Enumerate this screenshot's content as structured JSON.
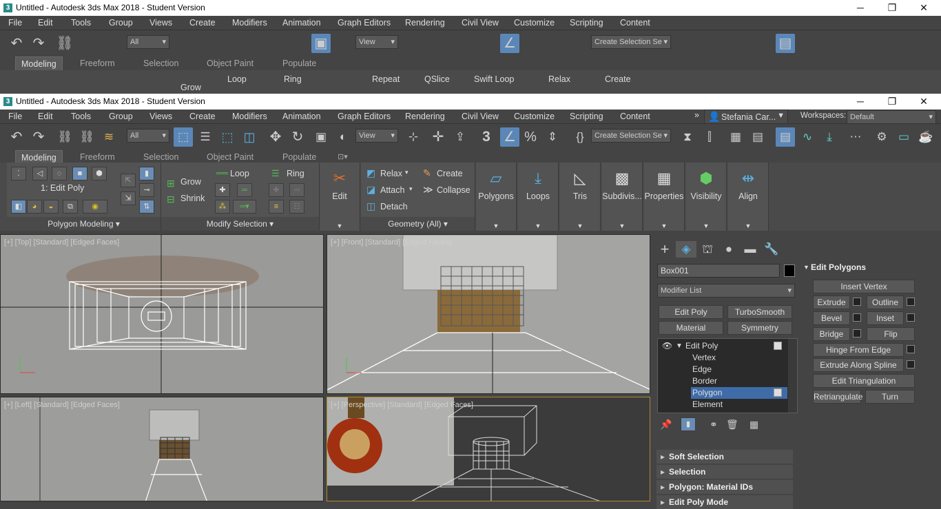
{
  "window": {
    "title": "Untitled - Autodesk 3ds Max 2018 - Student Version",
    "minimize": "─",
    "restore": "❐",
    "close": "✕"
  },
  "menu": [
    "File",
    "Edit",
    "Tools",
    "Group",
    "Views",
    "Create",
    "Modifiers",
    "Animation",
    "Graph Editors",
    "Rendering",
    "Civil View",
    "Customize",
    "Scripting",
    "Content"
  ],
  "user": {
    "name": "Stefania Car...",
    "workspaces_label": "Workspaces:",
    "workspace": "Default",
    "more": "»"
  },
  "toolbar": {
    "filter": "All",
    "view": "View",
    "selection_set": "Create Selection Se",
    "snap_label": "3"
  },
  "ribbon_tabs": [
    "Modeling",
    "Freeform",
    "Selection",
    "Object Paint",
    "Populate"
  ],
  "ribbon": {
    "edit_poly_label": "1: Edit Poly",
    "grow": "Grow",
    "shrink": "Shrink",
    "loop": "Loop",
    "ring": "Ring",
    "edit": "Edit",
    "relax": "Relax",
    "create": "Create",
    "attach": "Attach",
    "collapse": "Collapse",
    "detach": "Detach",
    "repeat": "Repeat",
    "qslice": "QSlice",
    "swift_loop": "Swift Loop",
    "big": [
      "Polygons",
      "Loops",
      "Tris",
      "Subdivis...",
      "Properties",
      "Visibility",
      "Align"
    ],
    "panel_polygon_modeling": "Polygon Modeling",
    "panel_modify_selection": "Modify Selection",
    "panel_geometry": "Geometry (All)"
  },
  "viewports": {
    "top": "[+] [Top] [Standard] [Edged Faces]",
    "front": "[+] [Front] [Standard] [Edged Faces]",
    "left": "[+] [Left] [Standard] [Edged Faces]",
    "persp": "[+] [Perspective] [Standard] [Edged Faces]"
  },
  "command_panel": {
    "object_name": "Box001",
    "modifier_list": "Modifier List",
    "buttons": [
      "Edit Poly",
      "TurboSmooth",
      "Material",
      "Symmetry"
    ],
    "stack": [
      "Edit Poly",
      "Vertex",
      "Edge",
      "Border",
      "Polygon",
      "Element"
    ],
    "rollouts": [
      "Soft Selection",
      "Selection",
      "Polygon: Material IDs",
      "Edit Poly Mode"
    ]
  },
  "edit_polygons": {
    "title": "Edit Polygons",
    "insert_vertex": "Insert Vertex",
    "extrude": "Extrude",
    "outline": "Outline",
    "bevel": "Bevel",
    "inset": "Inset",
    "bridge": "Bridge",
    "flip": "Flip",
    "hinge": "Hinge From Edge",
    "extrude_spline": "Extrude Along Spline",
    "edit_tri": "Edit Triangulation",
    "retriangulate": "Retriangulate",
    "turn": "Turn"
  },
  "colors": {
    "ui_bg": "#444444",
    "active_blue": "#5b87b8",
    "selected_row": "#3f6ca8"
  }
}
